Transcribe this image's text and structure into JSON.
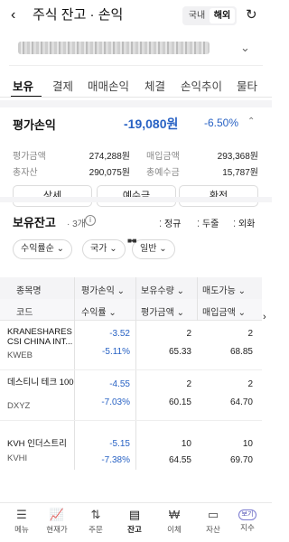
{
  "header": {
    "title": "주식 잔고 · 손익",
    "back_glyph": "‹",
    "segment": [
      "국내",
      "해외"
    ],
    "segment_active": "해외",
    "refresh_glyph": "↻"
  },
  "account": {
    "chevron": "⌄"
  },
  "tabs": [
    "보유",
    "결제",
    "매매손익",
    "체결",
    "손익추이",
    "물타"
  ],
  "evaluation": {
    "title": "평가손익",
    "amount": "-19,080원",
    "percent": "-6.50%",
    "chevron": "⌃",
    "rows": [
      {
        "l1": "평가금액",
        "v1": "274,288원",
        "l2": "매입금액",
        "v2": "293,368원"
      },
      {
        "l1": "총자산",
        "v1": "290,075원",
        "l2": "총예수금",
        "v2": "15,787원"
      }
    ],
    "buttons": [
      "상세",
      "예수금",
      "환전"
    ]
  },
  "holdings": {
    "title": "보유잔고",
    "count": "· 3개",
    "info": "i",
    "sort_options": [
      "정규",
      "두줄",
      "외화"
    ],
    "filters": [
      "수익률순",
      "국가",
      "일반"
    ],
    "filter_chevron": "⌄",
    "headers_top": [
      "종목명",
      "평가손익",
      "보유수량",
      "매도가능"
    ],
    "headers_bottom": [
      "코드",
      "수익률",
      "평가금액",
      "매입금액"
    ],
    "scroll_glyph": "›",
    "rows": [
      {
        "name": "KRANESHARES CSI CHINA INT...",
        "code": "KWEB",
        "pnl": "-3.52",
        "rate": "-5.11%",
        "qty": "2",
        "eval": "65.33",
        "sellable": "2",
        "cost": "68.85"
      },
      {
        "name": "데스티니 테크 100",
        "code": "DXYZ",
        "pnl": "-4.55",
        "rate": "-7.03%",
        "qty": "2",
        "eval": "60.15",
        "sellable": "2",
        "cost": "64.70"
      },
      {
        "name": "KVH 인더스트리",
        "code": "KVHI",
        "pnl": "-5.15",
        "rate": "-7.38%",
        "qty": "10",
        "eval": "64.55",
        "sellable": "10",
        "cost": "69.70"
      }
    ]
  },
  "bottom_nav": [
    {
      "label": "메뉴",
      "icon": "☰"
    },
    {
      "label": "현재가",
      "icon": "📈"
    },
    {
      "label": "주문",
      "icon": "⇅"
    },
    {
      "label": "잔고",
      "icon": "▤"
    },
    {
      "label": "이체",
      "icon": "₩"
    },
    {
      "label": "자산",
      "icon": "▭"
    },
    {
      "label": "지수",
      "badge": "보기"
    }
  ],
  "bottom_nav_active": "잔고",
  "colors": {
    "negative": "#2862c4",
    "accent_active": "#111111"
  }
}
